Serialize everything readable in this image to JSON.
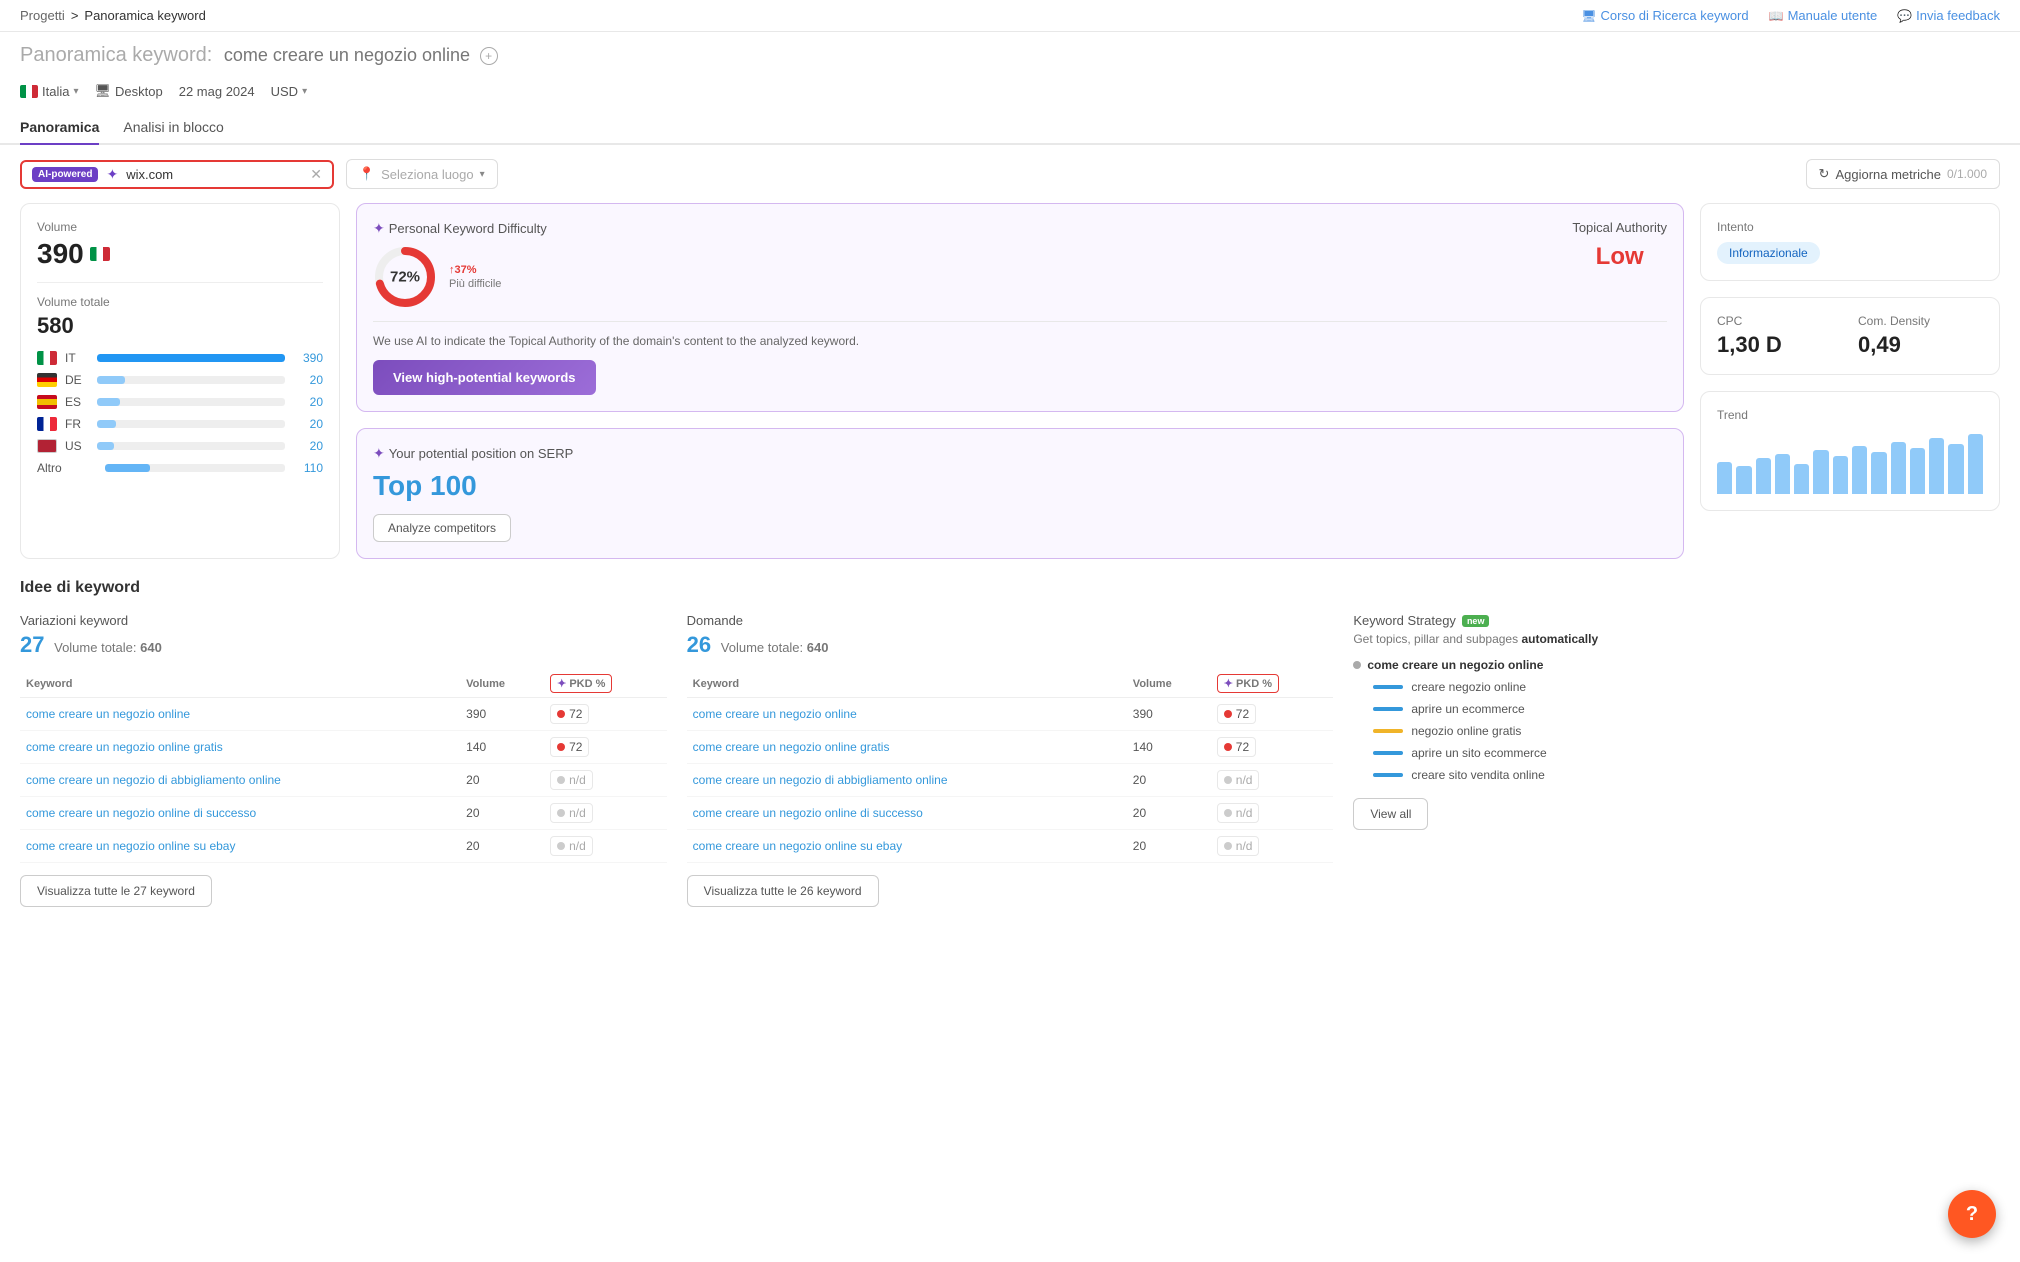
{
  "nav": {
    "breadcrumb_home": "Progetti",
    "breadcrumb_separator": ">",
    "breadcrumb_current": "Panoramica keyword",
    "link_corso": "Corso di Ricerca keyword",
    "link_manuale": "Manuale utente",
    "link_feedback": "Invia feedback"
  },
  "header": {
    "title_prefix": "Panoramica keyword:",
    "keyword": "come creare un negozio online",
    "locale": "Italia",
    "device": "Desktop",
    "date": "22 mag 2024",
    "currency": "USD"
  },
  "tabs": [
    {
      "id": "panoramica",
      "label": "Panoramica",
      "active": true
    },
    {
      "id": "analisi",
      "label": "Analisi in blocco",
      "active": false
    }
  ],
  "search": {
    "ai_badge": "AI-powered",
    "domain": "wix.com",
    "location_placeholder": "Seleziona luogo",
    "update_button": "Aggiorna metriche",
    "update_count": "0/1.000"
  },
  "volume_card": {
    "label": "Volume",
    "value": "390",
    "total_label": "Volume totale",
    "total_value": "580",
    "countries": [
      {
        "code": "IT",
        "value": 390,
        "bar_pct": 100
      },
      {
        "code": "DE",
        "value": 20,
        "bar_pct": 15
      },
      {
        "code": "ES",
        "value": 20,
        "bar_pct": 15
      },
      {
        "code": "FR",
        "value": 20,
        "bar_pct": 15
      },
      {
        "code": "US",
        "value": 20,
        "bar_pct": 15
      }
    ],
    "altro_label": "Altro",
    "altro_value": 110
  },
  "pkd_card": {
    "title": "Personal Keyword Difficulty",
    "spark_icon": "✦",
    "pct": "72%",
    "change": "↑37%",
    "sub": "Più difficile",
    "topical_label": "Topical Authority",
    "topical_value": "Low",
    "description": "We use AI to indicate the Topical Authority of the domain's content to the analyzed keyword.",
    "button_label": "View high-potential keywords",
    "serp_title": "Your potential position on SERP",
    "serp_spark": "✦",
    "serp_value": "Top 100",
    "analyze_btn": "Analyze competitors"
  },
  "right_col": {
    "intent_label": "Intento",
    "intent_badge": "Informazionale",
    "cpc_label": "CPC",
    "cpc_value": "1,30 D",
    "density_label": "Com. Density",
    "density_value": "0,49",
    "trend_label": "Trend",
    "trend_bars": [
      40,
      35,
      45,
      50,
      38,
      55,
      48,
      60,
      52,
      65,
      58,
      70,
      62,
      75
    ]
  },
  "ideas": {
    "section_title": "Idee di keyword",
    "variations": {
      "title": "Variazioni keyword",
      "count": "27",
      "vol_label": "Volume totale:",
      "vol_value": "640",
      "col_keyword": "Keyword",
      "col_volume": "Volume",
      "col_pkd": "PKD %",
      "rows": [
        {
          "keyword": "come creare un negozio online",
          "volume": "390",
          "pkd": "72",
          "pkd_dot": "red"
        },
        {
          "keyword": "come creare un negozio online gratis",
          "volume": "140",
          "pkd": "72",
          "pkd_dot": "red"
        },
        {
          "keyword": "come creare un negozio di abbigliamento online",
          "volume": "20",
          "pkd": "n/d",
          "pkd_dot": "gray"
        },
        {
          "keyword": "come creare un negozio online di successo",
          "volume": "20",
          "pkd": "n/d",
          "pkd_dot": "gray"
        },
        {
          "keyword": "come creare un negozio online su ebay",
          "volume": "20",
          "pkd": "n/d",
          "pkd_dot": "gray"
        }
      ],
      "view_all_btn": "Visualizza tutte le 27 keyword"
    },
    "domande": {
      "title": "Domande",
      "count": "26",
      "vol_label": "Volume totale:",
      "vol_value": "640",
      "col_keyword": "Keyword",
      "col_volume": "Volume",
      "col_pkd": "PKD %",
      "rows": [
        {
          "keyword": "come creare un negozio online",
          "volume": "390",
          "pkd": "72",
          "pkd_dot": "red"
        },
        {
          "keyword": "come creare un negozio online gratis",
          "volume": "140",
          "pkd": "72",
          "pkd_dot": "red"
        },
        {
          "keyword": "come creare un negozio di abbigliamento online",
          "volume": "20",
          "pkd": "n/d",
          "pkd_dot": "gray"
        },
        {
          "keyword": "come creare un negozio online di successo",
          "volume": "20",
          "pkd": "n/d",
          "pkd_dot": "gray"
        },
        {
          "keyword": "come creare un negozio online su ebay",
          "volume": "20",
          "pkd": "n/d",
          "pkd_dot": "gray"
        }
      ],
      "view_all_btn": "Visualizza tutte le 26 keyword"
    },
    "strategy": {
      "title": "Keyword Strategy",
      "new_badge": "new",
      "desc_1": "Get topics, pillar and subpages",
      "desc_2": "automatically",
      "root_label": "come creare un negozio online",
      "children": [
        {
          "label": "creare negozio online",
          "color": "#3498db"
        },
        {
          "label": "aprire un ecommerce",
          "color": "#3498db"
        },
        {
          "label": "negozio online gratis",
          "color": "#f0b429"
        },
        {
          "label": "aprire un sito ecommerce",
          "color": "#3498db"
        },
        {
          "label": "creare sito vendita online",
          "color": "#3498db"
        }
      ],
      "view_all_btn": "View all"
    }
  }
}
